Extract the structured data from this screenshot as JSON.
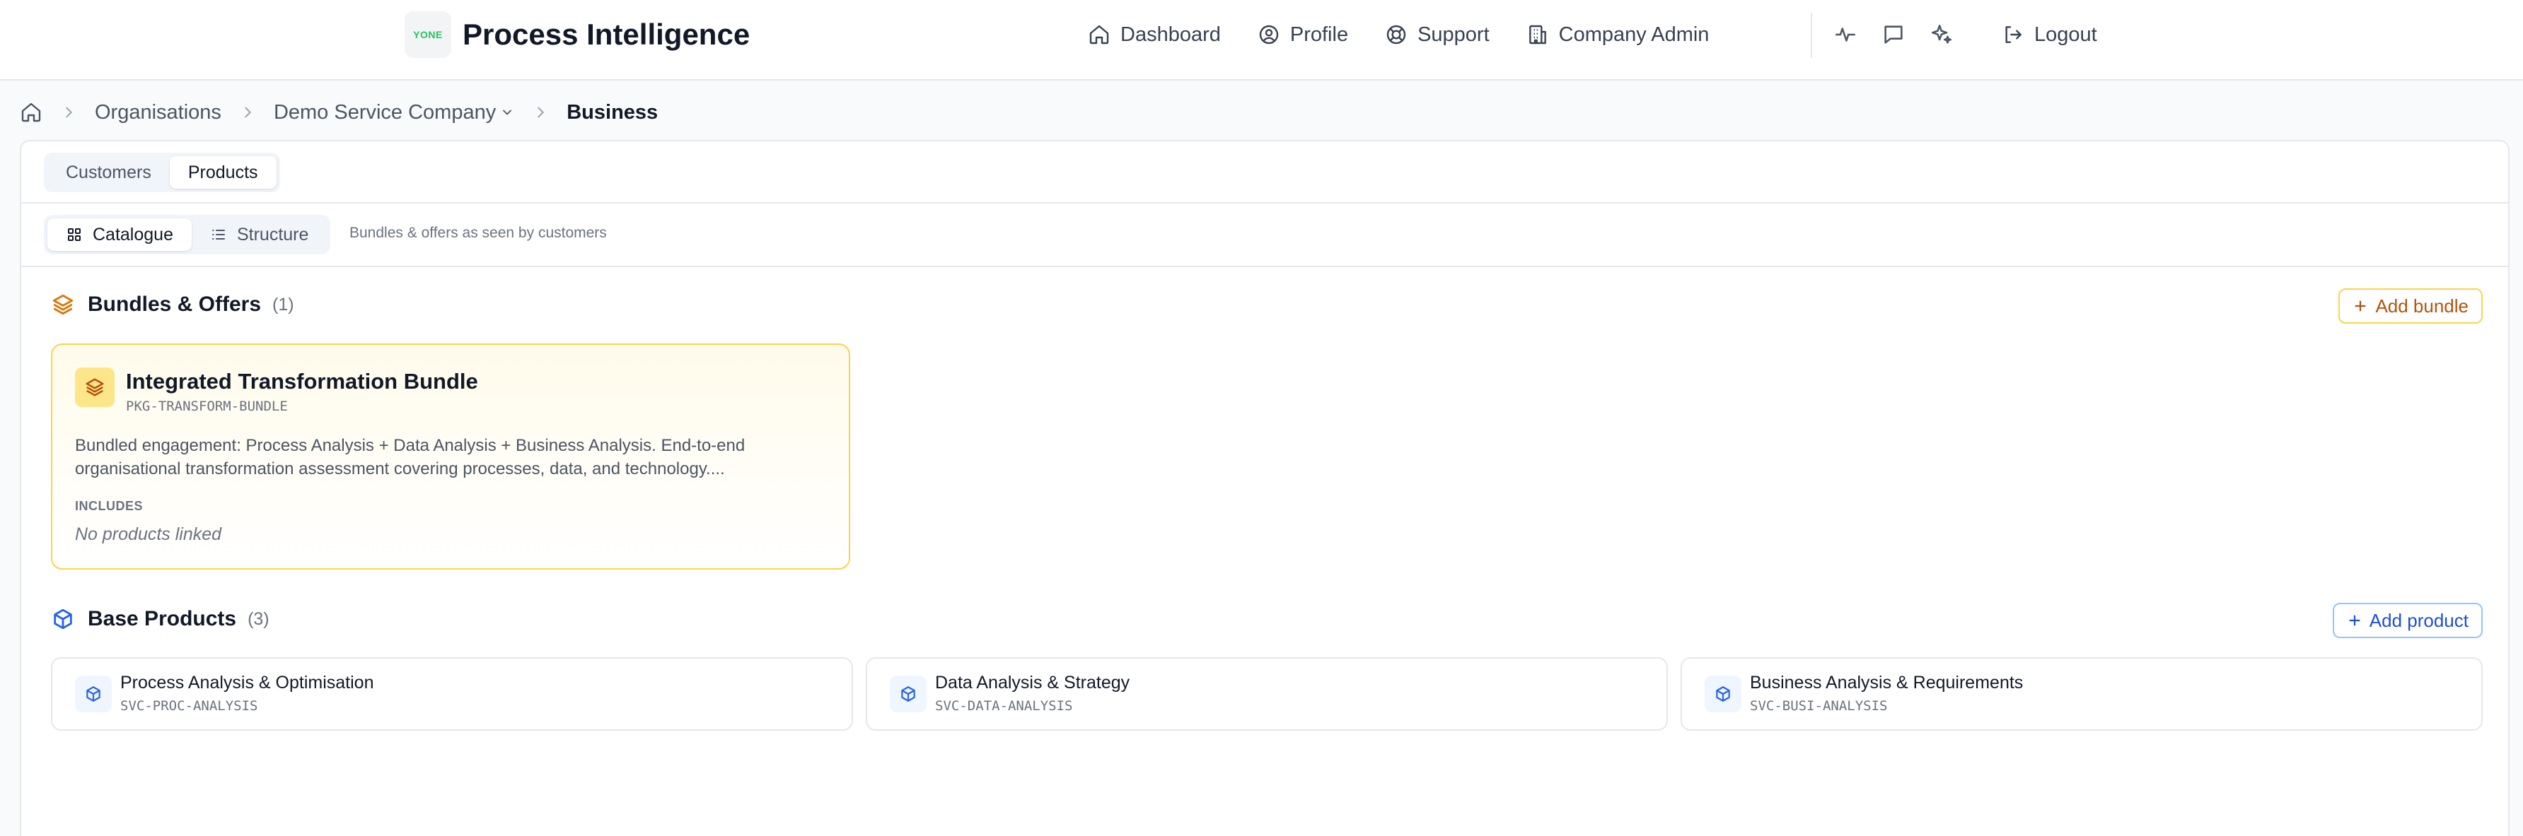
{
  "header": {
    "logo_text": "YONE",
    "app_title": "Process Intelligence",
    "nav": [
      {
        "label": "Dashboard",
        "icon": "home-icon"
      },
      {
        "label": "Profile",
        "icon": "user-circle-icon"
      },
      {
        "label": "Support",
        "icon": "lifebuoy-icon"
      },
      {
        "label": "Company Admin",
        "icon": "building-icon"
      }
    ],
    "icon_buttons": [
      "activity-icon",
      "chat-icon",
      "sparkles-icon"
    ],
    "logout_label": "Logout"
  },
  "breadcrumb": {
    "items": [
      "Organisations",
      "Demo Service Company",
      "Business"
    ]
  },
  "tabs": {
    "items": [
      "Customers",
      "Products"
    ],
    "active": "Products"
  },
  "view_toggle": {
    "items": [
      "Catalogue",
      "Structure"
    ],
    "active": "Catalogue",
    "description": "Bundles & offers as seen by customers"
  },
  "bundles": {
    "title": "Bundles & Offers",
    "count": "(1)",
    "add_label": "Add bundle",
    "items": [
      {
        "name": "Integrated Transformation Bundle",
        "code": "PKG-TRANSFORM-BUNDLE",
        "description": "Bundled engagement: Process Analysis + Data Analysis + Business Analysis. End-to-end organisational transformation assessment covering processes, data, and technology....",
        "includes_label": "INCLUDES",
        "includes_empty": "No products linked"
      }
    ]
  },
  "products": {
    "title": "Base Products",
    "count": "(3)",
    "add_label": "Add product",
    "items": [
      {
        "name": "Process Analysis & Optimisation",
        "code": "SVC-PROC-ANALYSIS"
      },
      {
        "name": "Data Analysis & Strategy",
        "code": "SVC-DATA-ANALYSIS"
      },
      {
        "name": "Business Analysis & Requirements",
        "code": "SVC-BUSI-ANALYSIS"
      }
    ]
  },
  "colors": {
    "accent_amber": "#f59e0b",
    "accent_blue": "#2563eb",
    "logo_green": "#22c55e"
  }
}
